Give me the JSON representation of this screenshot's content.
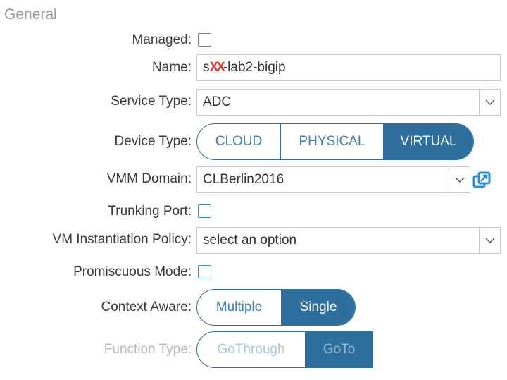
{
  "section": {
    "title": "General"
  },
  "managed": {
    "label": "Managed:",
    "checked": false
  },
  "name": {
    "label": "Name:",
    "prefix": "s",
    "redacted": "XX",
    "suffix": "-lab2-bigip"
  },
  "service_type": {
    "label": "Service Type:",
    "value": "ADC"
  },
  "device_type": {
    "label": "Device Type:",
    "options": [
      "CLOUD",
      "PHYSICAL",
      "VIRTUAL"
    ],
    "selected": "VIRTUAL"
  },
  "vmm_domain": {
    "label": "VMM Domain:",
    "value": "CLBerlin2016",
    "link_icon": "external-link-icon"
  },
  "trunking_port": {
    "label": "Trunking Port:",
    "checked": false
  },
  "vm_policy": {
    "label": "VM Instantiation Policy:",
    "value": "select an option"
  },
  "promiscuous": {
    "label": "Promiscuous Mode:",
    "checked": false
  },
  "context_aware": {
    "label": "Context Aware:",
    "options": [
      "Multiple",
      "Single"
    ],
    "selected": "Single"
  },
  "function_type": {
    "label": "Function Type:",
    "options": [
      "GoThrough",
      "GoTo"
    ],
    "selected": "GoTo",
    "disabled": true
  },
  "colors": {
    "accent": "#2e6f9e",
    "checkbox_border": "#3a8fc4",
    "redaction": "#e03a2e",
    "section_title": "#9a9a9a",
    "disabled_label": "#b9b9b9"
  }
}
